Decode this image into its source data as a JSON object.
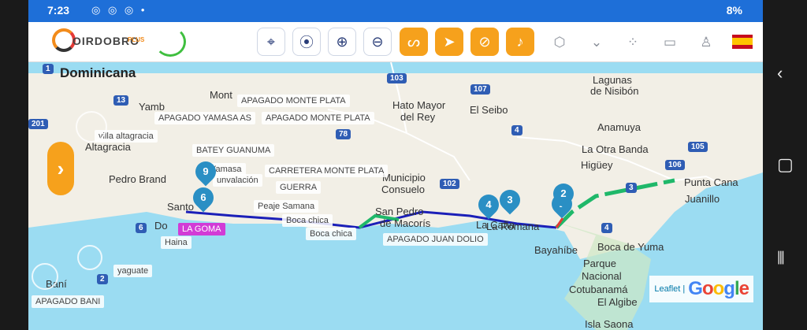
{
  "status": {
    "time": "7:23",
    "notification_icons": "◎ ◎ ◎ •",
    "right_text": "8%"
  },
  "toolbar": {
    "logo_text": "OIRDOBRO",
    "logo_sub": "PLUS",
    "buttons": [
      {
        "name": "locate-button",
        "icon": "crosshair-icon",
        "glyph": "⌖",
        "style": "outline"
      },
      {
        "name": "pin-button",
        "icon": "map-pin-icon",
        "glyph": "⦿",
        "style": "outline"
      },
      {
        "name": "zoom-in-button",
        "icon": "plus-circle-icon",
        "glyph": "⊕",
        "style": "outline"
      },
      {
        "name": "zoom-out-button",
        "icon": "minus-circle-icon",
        "glyph": "⊖",
        "style": "outline"
      },
      {
        "name": "route-button",
        "icon": "route-icon",
        "glyph": "ᔕ",
        "style": "orange"
      },
      {
        "name": "navigate-button",
        "icon": "navigation-arrow-icon",
        "glyph": "➤",
        "style": "orange"
      },
      {
        "name": "search-route-button",
        "icon": "search-circle-icon",
        "glyph": "⊘",
        "style": "orange"
      },
      {
        "name": "alerts-button",
        "icon": "bell-icon",
        "glyph": "♪",
        "style": "orange"
      }
    ],
    "plain_icons": [
      {
        "name": "settings-hex-icon",
        "glyph": "⬡"
      },
      {
        "name": "chevron-down-icon",
        "glyph": "⌄"
      },
      {
        "name": "grid-icon",
        "glyph": "⁘"
      },
      {
        "name": "chat-icon",
        "glyph": "▭"
      },
      {
        "name": "user-icon",
        "glyph": "♙"
      }
    ],
    "language_flag": "es-flag-icon"
  },
  "map": {
    "places": [
      {
        "text": "Dominicana",
        "big": true
      },
      {
        "text": "Yamb"
      },
      {
        "text": "Mont"
      },
      {
        "text": "Altagracia"
      },
      {
        "text": "Pedro Brand"
      },
      {
        "text": "Santo"
      },
      {
        "text": "Do"
      },
      {
        "text": "Hato Mayor"
      },
      {
        "text": "del Rey"
      },
      {
        "text": "El Seibo"
      },
      {
        "text": "Lagunas"
      },
      {
        "text": "de Nisibón"
      },
      {
        "text": "Anamuya"
      },
      {
        "text": "La Otra Banda"
      },
      {
        "text": "Higüey"
      },
      {
        "text": "Punta Cana"
      },
      {
        "text": "Juanillo"
      },
      {
        "text": "Municipio"
      },
      {
        "text": "Consuelo"
      },
      {
        "text": "San Pedro"
      },
      {
        "text": "de Macorís"
      },
      {
        "text": "La Caña"
      },
      {
        "text": "La Romana"
      },
      {
        "text": "Bayahíbe"
      },
      {
        "text": "Boca de Yuma"
      },
      {
        "text": "Parque"
      },
      {
        "text": "Nacional"
      },
      {
        "text": "Cotubanamá"
      },
      {
        "text": "El Algibe"
      },
      {
        "text": "Isla Saona"
      },
      {
        "text": "Baní"
      }
    ],
    "tags": [
      {
        "text": "APAGADO MONTE PLATA",
        "pink": false
      },
      {
        "text": "APAGADO YAMASA AS",
        "pink": false
      },
      {
        "text": "APAGADO MONTE PLATA",
        "pink": false
      },
      {
        "text": "villa altagracia",
        "pink": false
      },
      {
        "text": "BATEY GUANUMA",
        "pink": false
      },
      {
        "text": "CARRETERA MONTE PLATA",
        "pink": false
      },
      {
        "text": "GUERRA",
        "pink": false
      },
      {
        "text": "Yamasa",
        "pink": false
      },
      {
        "text": "unvalación",
        "pink": false
      },
      {
        "text": "Peaje Samana",
        "pink": false
      },
      {
        "text": "Boca chica",
        "pink": false
      },
      {
        "text": "Boca chica",
        "pink": false
      },
      {
        "text": "LA GOMA",
        "pink": true
      },
      {
        "text": "Haina",
        "pink": false
      },
      {
        "text": "yaguate",
        "pink": false
      },
      {
        "text": "APAGADO BANI",
        "pink": false
      },
      {
        "text": "APAGADO JUAN DOLIO",
        "pink": false
      }
    ],
    "shields": [
      "1",
      "13",
      "201",
      "103",
      "107",
      "4",
      "78",
      "3",
      "105",
      "106",
      "102",
      "6",
      "2",
      "4"
    ],
    "markers": [
      "9",
      "6",
      "4",
      "3",
      "1",
      "2"
    ],
    "attribution": {
      "leaflet": "Leaflet |",
      "google": "Google"
    }
  },
  "colors": {
    "accent": "#f6a11c",
    "statusbar": "#1e6fd8",
    "route_blue": "#1b1fb8",
    "route_green": "#1fb86a",
    "marker": "#2a8fc4"
  }
}
